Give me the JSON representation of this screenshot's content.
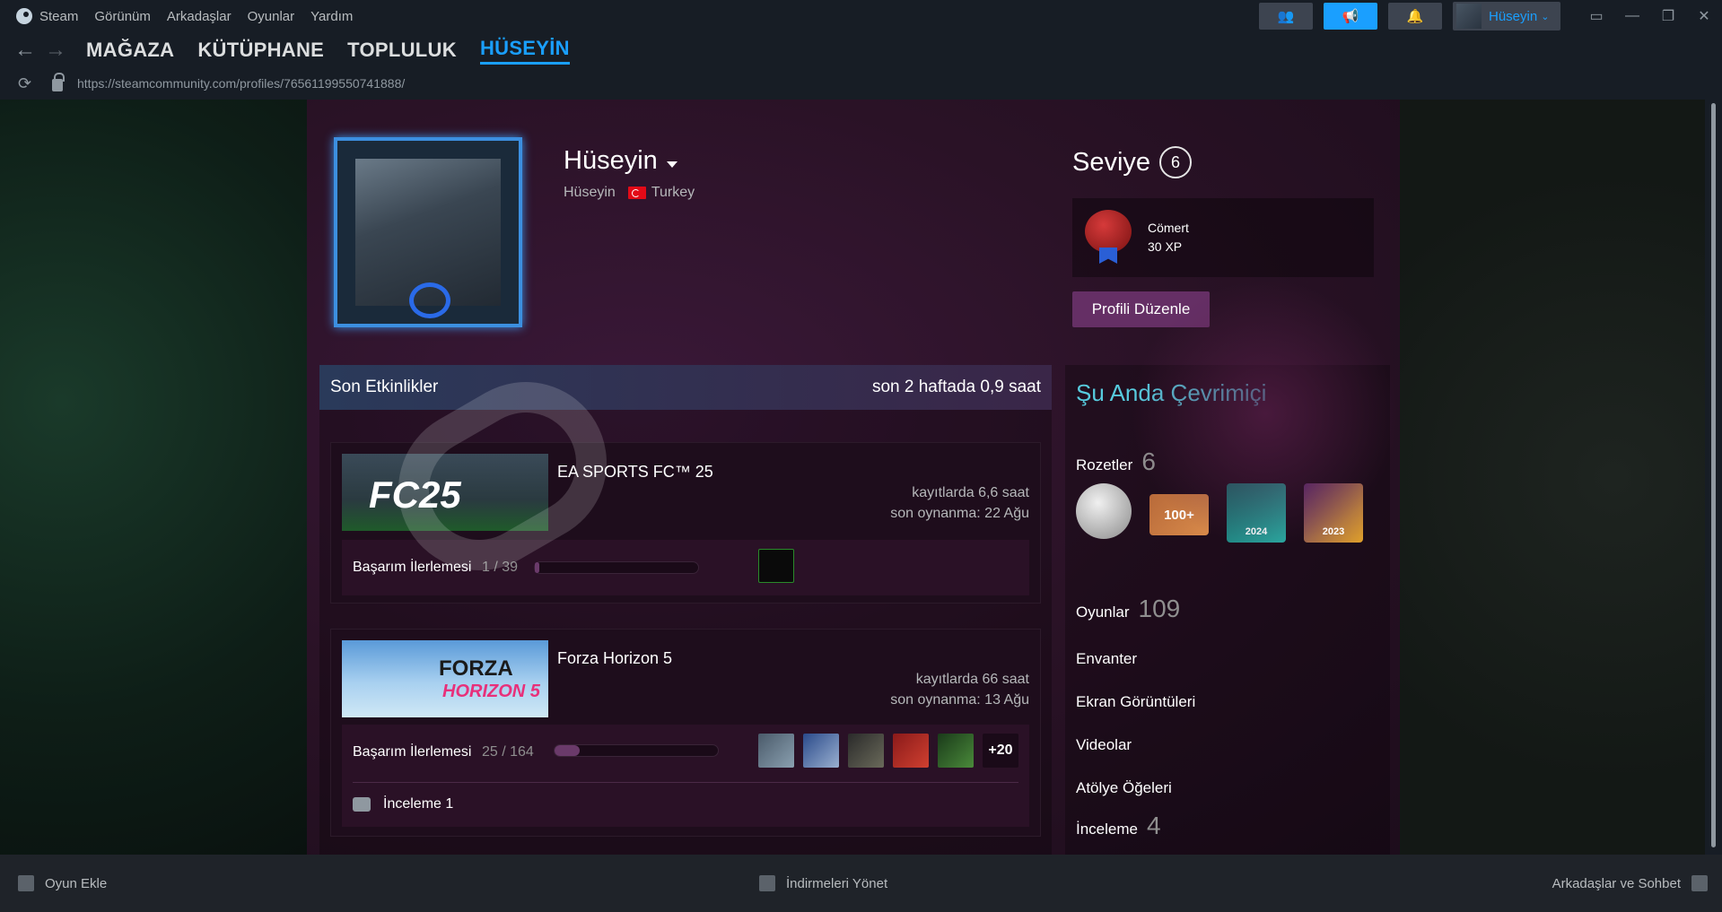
{
  "menu": {
    "app": "Steam",
    "items": [
      "Görünüm",
      "Arkadaşlar",
      "Oyunlar",
      "Yardım"
    ]
  },
  "user_pill": {
    "name": "Hüseyin"
  },
  "nav": {
    "tabs": [
      "MAĞAZA",
      "KÜTÜPHANE",
      "TOPLULUK",
      "HÜSEYİN"
    ],
    "active": "HÜSEYİN"
  },
  "address": {
    "url": "https://steamcommunity.com/profiles/76561199550741888/"
  },
  "profile": {
    "name": "Hüseyin",
    "real_name": "Hüseyin",
    "country": "Turkey",
    "level_label": "Seviye",
    "level": "6",
    "featured_badge": {
      "name": "Cömert",
      "xp": "30 XP"
    },
    "edit_button": "Profili Düzenle"
  },
  "recent": {
    "title": "Son Etkinlikler",
    "summary": "son 2 haftada 0,9 saat",
    "games": [
      {
        "name": "EA SPORTS FC™ 25",
        "hours": "kayıtlarda 6,6 saat",
        "last_played": "son oynanma: 22 Ağu",
        "ach_label": "Başarım İlerlemesi",
        "ach_count": "1 / 39",
        "ach_progress": 0.026
      },
      {
        "name": "Forza Horizon 5",
        "hours": "kayıtlarda 66 saat",
        "last_played": "son oynanma: 13 Ağu",
        "ach_label": "Başarım İlerlemesi",
        "ach_count": "25 / 164",
        "ach_progress": 0.152,
        "more": "+20",
        "review": "İnceleme 1"
      }
    ]
  },
  "sidebar": {
    "status": "Şu Anda Çevrimiçi",
    "badges_label": "Rozetler",
    "badges_count": "6",
    "badge_year_a": "2024",
    "badge_year_b": "2023",
    "badge_hundred": "100+",
    "games_label": "Oyunlar",
    "games_count": "109",
    "inventory": "Envanter",
    "screenshots": "Ekran Görüntüleri",
    "videos": "Videolar",
    "workshop": "Atölye Öğeleri",
    "reviews_label": "İnceleme",
    "reviews_count": "4"
  },
  "bottom": {
    "add_game": "Oyun Ekle",
    "downloads": "İndirmeleri Yönet",
    "friends": "Arkadaşlar ve Sohbet"
  },
  "colors": {
    "accent": "#1a9fff",
    "online": "#57cbde",
    "edit_button": "#652f65"
  }
}
